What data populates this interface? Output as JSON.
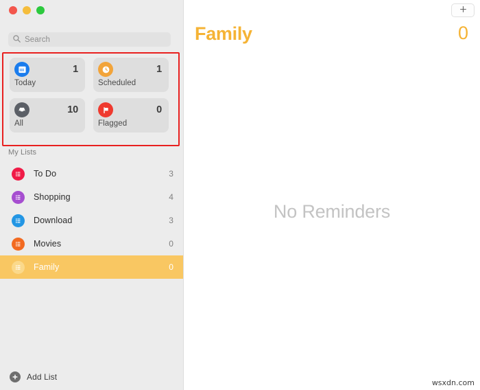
{
  "window": {
    "traffic_lights": [
      {
        "name": "close",
        "color": "#f3564c"
      },
      {
        "name": "minimize",
        "color": "#f5bd3c"
      },
      {
        "name": "maximize",
        "color": "#2cc93e"
      }
    ]
  },
  "sidebar": {
    "search": {
      "placeholder": "Search",
      "value": "",
      "icon": "search-icon"
    },
    "smart_lists": [
      {
        "label": "Today",
        "count": "1",
        "icon": "calendar-icon",
        "color": "#1a7ced"
      },
      {
        "label": "Scheduled",
        "count": "1",
        "icon": "clock-icon",
        "color": "#f2a43a"
      },
      {
        "label": "All",
        "count": "10",
        "icon": "inbox-tray-icon",
        "color": "#5b5f66"
      },
      {
        "label": "Flagged",
        "count": "0",
        "icon": "flag-icon",
        "color": "#ef3a2f"
      }
    ],
    "my_lists_header": "My Lists",
    "lists": [
      {
        "label": "To Do",
        "count": "3",
        "icon": "list-bullets-icon",
        "color": "#f01b47",
        "selected": false
      },
      {
        "label": "Shopping",
        "count": "4",
        "icon": "list-bullets-icon",
        "color": "#a64ed0",
        "selected": false
      },
      {
        "label": "Download",
        "count": "3",
        "icon": "list-bullets-icon",
        "color": "#2396e4",
        "selected": false
      },
      {
        "label": "Movies",
        "count": "0",
        "icon": "list-bullets-icon",
        "color": "#f26a21",
        "selected": false
      },
      {
        "label": "Family",
        "count": "0",
        "icon": "list-bullets-icon",
        "color": "#fbd98b",
        "selected": true
      }
    ],
    "add_list": {
      "label": "Add List",
      "icon": "plus-circle-icon"
    }
  },
  "main": {
    "add_reminder_icon": "plus-icon",
    "title": "Family",
    "count": "0",
    "empty_state": "No Reminders",
    "accent_color": "#f5b335"
  },
  "watermark": "wsxdn.com",
  "annotation": {
    "type": "red-rectangle-highlight",
    "color": "#e8201f",
    "targets": "smart-lists-grid"
  }
}
